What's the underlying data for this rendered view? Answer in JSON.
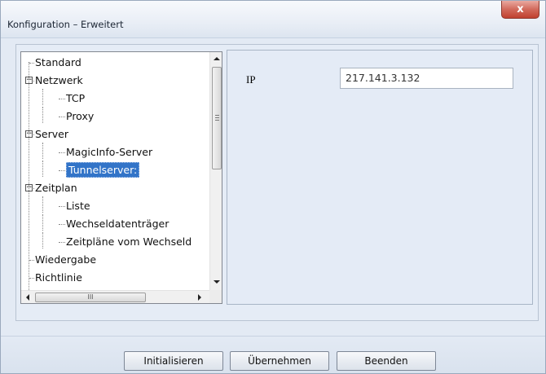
{
  "window": {
    "title": "Konfiguration – Erweitert",
    "close_label": "x"
  },
  "tree": {
    "items": [
      {
        "label": "Standard",
        "level": 0,
        "expandable": false
      },
      {
        "label": "Netzwerk",
        "level": 0,
        "expandable": true,
        "expanded": true
      },
      {
        "label": "TCP",
        "level": 1,
        "expandable": false
      },
      {
        "label": "Proxy",
        "level": 1,
        "expandable": false
      },
      {
        "label": "Server",
        "level": 0,
        "expandable": true,
        "expanded": true
      },
      {
        "label": "MagicInfo-Server",
        "level": 1,
        "expandable": false
      },
      {
        "label": "Tunnelserver:",
        "level": 1,
        "expandable": false,
        "selected": true
      },
      {
        "label": "Zeitplan",
        "level": 0,
        "expandable": true,
        "expanded": true
      },
      {
        "label": "Liste",
        "level": 1,
        "expandable": false
      },
      {
        "label": "Wechseldatenträger",
        "level": 1,
        "expandable": false
      },
      {
        "label": "Zeitpläne vom Wechseld",
        "level": 1,
        "expandable": false
      },
      {
        "label": "Wiedergabe",
        "level": 0,
        "expandable": false
      },
      {
        "label": "Richtlinie",
        "level": 0,
        "expandable": false
      }
    ],
    "hscroll_grip": "III"
  },
  "panel": {
    "ip_label": "IP",
    "ip_value": "217.141.3.132"
  },
  "buttons": {
    "initialize": "Initialisieren",
    "apply": "Übernehmen",
    "quit": "Beenden"
  }
}
